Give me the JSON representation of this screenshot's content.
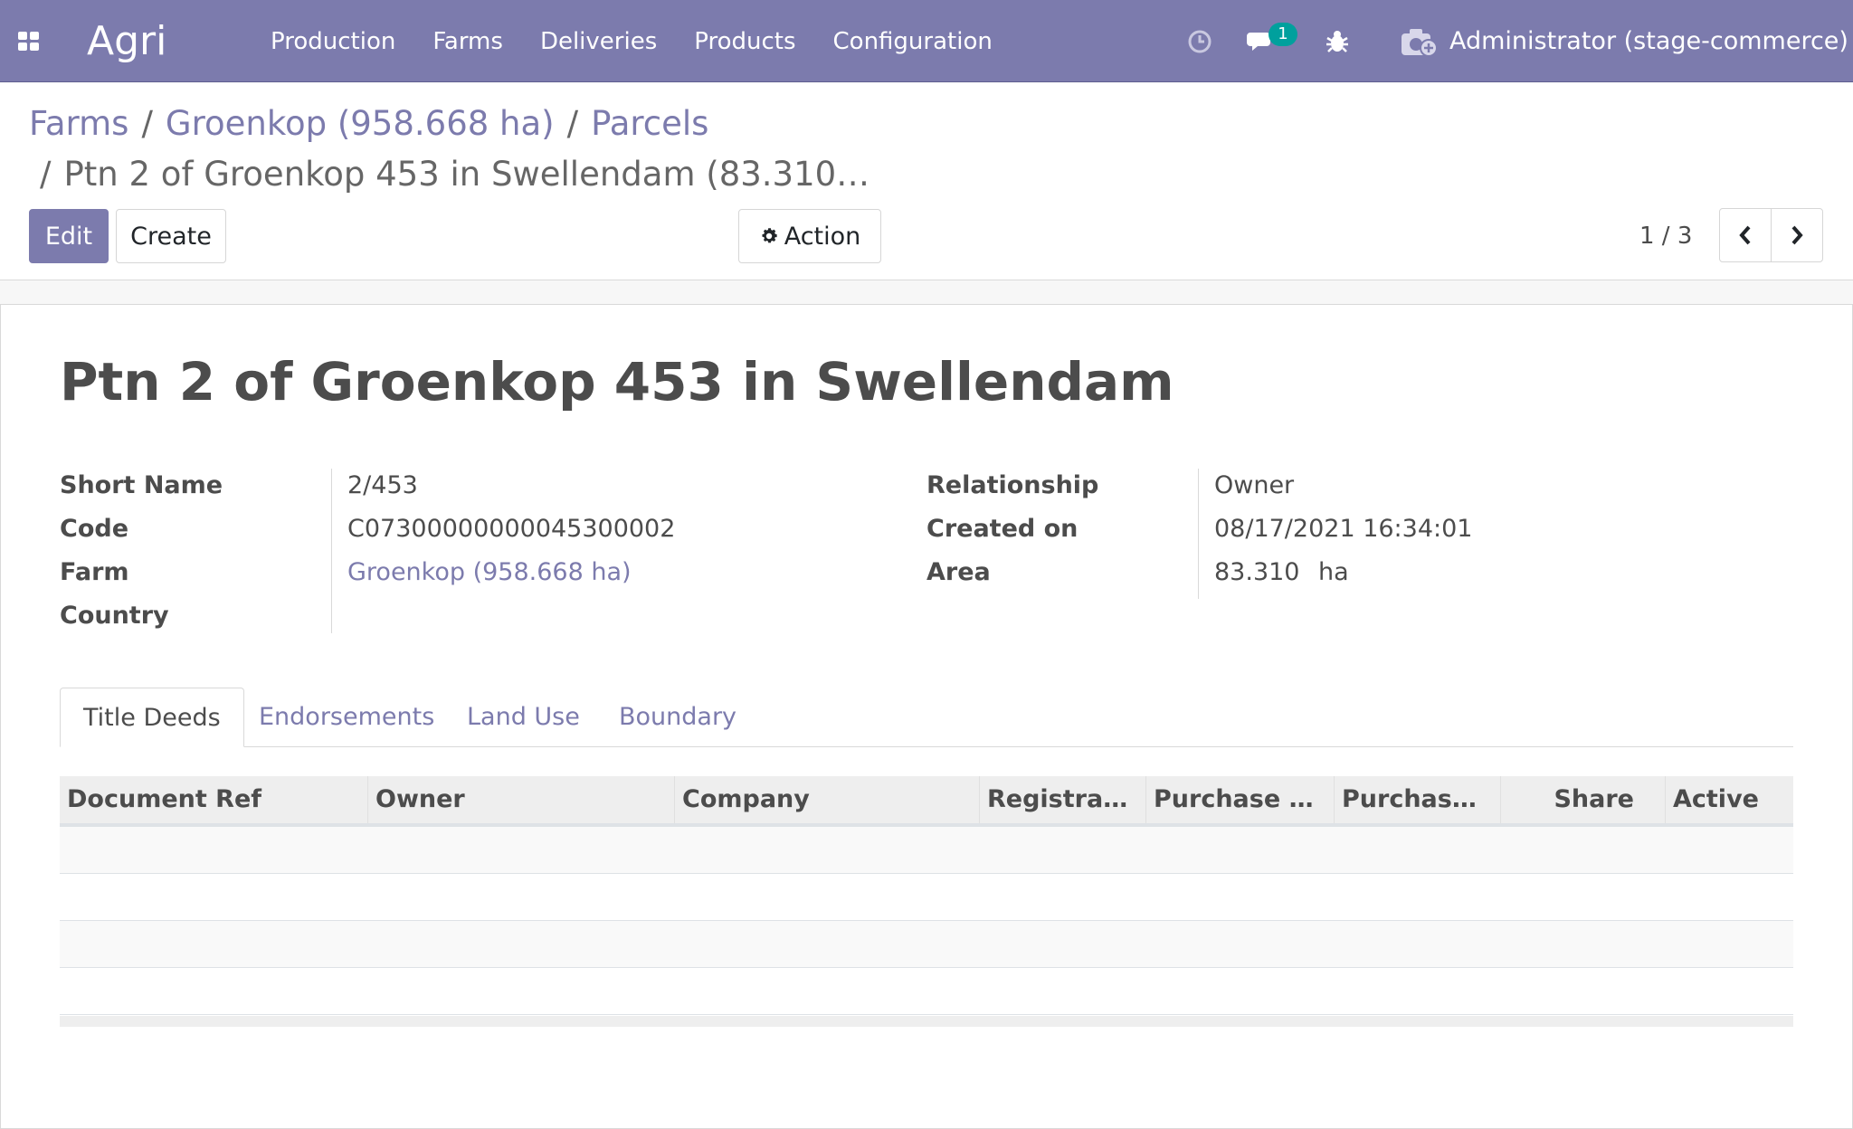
{
  "navbar": {
    "brand": "Agri",
    "menu": [
      "Production",
      "Farms",
      "Deliveries",
      "Products",
      "Configuration"
    ],
    "messages_count": "1",
    "user": "Administrator (stage-commerce)"
  },
  "breadcrumb": {
    "items": [
      "Farms",
      "Groenkop (958.668 ha)",
      "Parcels"
    ],
    "current": "Ptn 2 of Groenkop 453 in Swellendam (83.310…"
  },
  "buttons": {
    "edit": "Edit",
    "create": "Create",
    "action": "Action"
  },
  "pager": {
    "value": "1 / 3"
  },
  "record": {
    "title": "Ptn 2 of Groenkop 453 in Swellendam",
    "left_fields": [
      {
        "label": "Short Name",
        "value": "2/453"
      },
      {
        "label": "Code",
        "value": "C07300000000045300002"
      },
      {
        "label": "Farm",
        "value": "Groenkop (958.668 ha)"
      },
      {
        "label": "Country",
        "value": ""
      }
    ],
    "right_fields": [
      {
        "label": "Relationship",
        "value": "Owner"
      },
      {
        "label": "Created on",
        "value": "08/17/2021 16:34:01"
      },
      {
        "label": "Area",
        "value": "83.310",
        "unit": "ha"
      }
    ]
  },
  "tabs": [
    "Title Deeds",
    "Endorsements",
    "Land Use",
    "Boundary"
  ],
  "table": {
    "columns": [
      "Document Ref",
      "Owner",
      "Company",
      "Registrati…",
      "Purchase Pr…",
      "Purchase …",
      "Share",
      "Active"
    ]
  },
  "colors": {
    "brand": "#7c7bad",
    "badge": "#00a09d"
  }
}
